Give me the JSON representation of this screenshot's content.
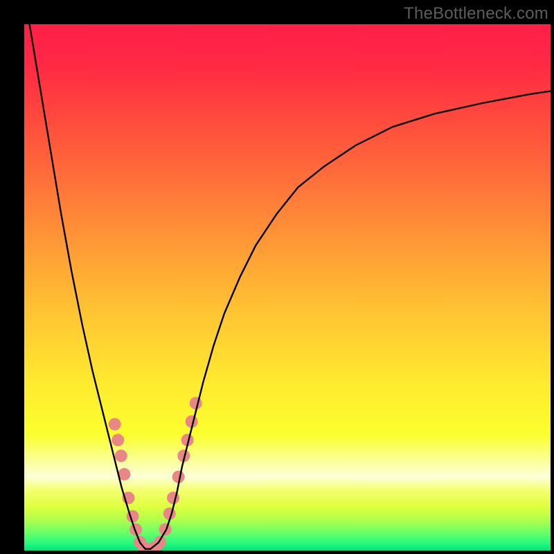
{
  "watermark": "TheBottleneck.com",
  "gradient_stops": [
    {
      "offset": 0.0,
      "color": "#ff1f49"
    },
    {
      "offset": 0.08,
      "color": "#ff2a44"
    },
    {
      "offset": 0.18,
      "color": "#ff4a3d"
    },
    {
      "offset": 0.3,
      "color": "#ff713a"
    },
    {
      "offset": 0.42,
      "color": "#ff9a36"
    },
    {
      "offset": 0.55,
      "color": "#ffc533"
    },
    {
      "offset": 0.68,
      "color": "#ffe92f"
    },
    {
      "offset": 0.78,
      "color": "#fbff2e"
    },
    {
      "offset": 0.835,
      "color": "#fbffa5"
    },
    {
      "offset": 0.86,
      "color": "#fcffd7"
    },
    {
      "offset": 0.885,
      "color": "#f5ff70"
    },
    {
      "offset": 0.915,
      "color": "#e0ff40"
    },
    {
      "offset": 0.94,
      "color": "#b5ff4a"
    },
    {
      "offset": 0.965,
      "color": "#6dff68"
    },
    {
      "offset": 0.985,
      "color": "#2bfa7e"
    },
    {
      "offset": 1.0,
      "color": "#00e47a"
    }
  ],
  "chart_data": {
    "type": "line",
    "title": "",
    "xlabel": "",
    "ylabel": "",
    "xlim": [
      0,
      100
    ],
    "ylim": [
      0,
      100
    ],
    "series": [
      {
        "name": "bottleneck-curve",
        "x": [
          1,
          3,
          5,
          7,
          9,
          11,
          13,
          15,
          17,
          18.5,
          20,
          21,
          22,
          23,
          24,
          25.5,
          27,
          28,
          29,
          30,
          32,
          34,
          36,
          38,
          41,
          44,
          48,
          52,
          57,
          63,
          70,
          78,
          87,
          96,
          100
        ],
        "values": [
          100,
          88,
          76,
          64,
          53,
          43,
          34,
          26,
          18,
          12,
          7,
          4,
          1.5,
          0.3,
          0.3,
          1.5,
          4,
          7,
          11,
          16,
          24,
          32,
          39,
          45,
          52,
          58,
          64,
          69,
          73,
          77,
          80.5,
          83,
          85,
          86.7,
          87.3
        ]
      }
    ],
    "markers": [
      {
        "name": "left-cluster",
        "color": "#e98787",
        "points": [
          {
            "x": 17.2,
            "value": 24.0
          },
          {
            "x": 17.8,
            "value": 21.0
          },
          {
            "x": 18.4,
            "value": 18.0
          },
          {
            "x": 19.0,
            "value": 14.5
          },
          {
            "x": 19.8,
            "value": 10.0
          },
          {
            "x": 20.6,
            "value": 6.5
          },
          {
            "x": 21.2,
            "value": 4.0
          },
          {
            "x": 22.0,
            "value": 1.6
          }
        ]
      },
      {
        "name": "valley-cluster",
        "color": "#e98787",
        "points": [
          {
            "x": 22.8,
            "value": 0.35
          },
          {
            "x": 23.5,
            "value": 0.3
          },
          {
            "x": 24.2,
            "value": 0.35
          },
          {
            "x": 25.0,
            "value": 0.7
          },
          {
            "x": 25.8,
            "value": 1.6
          }
        ]
      },
      {
        "name": "right-cluster",
        "color": "#e98787",
        "points": [
          {
            "x": 26.8,
            "value": 4.0
          },
          {
            "x": 27.6,
            "value": 7.0
          },
          {
            "x": 28.3,
            "value": 10.0
          },
          {
            "x": 29.3,
            "value": 14.0
          },
          {
            "x": 30.3,
            "value": 18.0
          },
          {
            "x": 31.0,
            "value": 21.0
          },
          {
            "x": 31.8,
            "value": 24.5
          },
          {
            "x": 32.6,
            "value": 28.0
          }
        ]
      }
    ]
  }
}
